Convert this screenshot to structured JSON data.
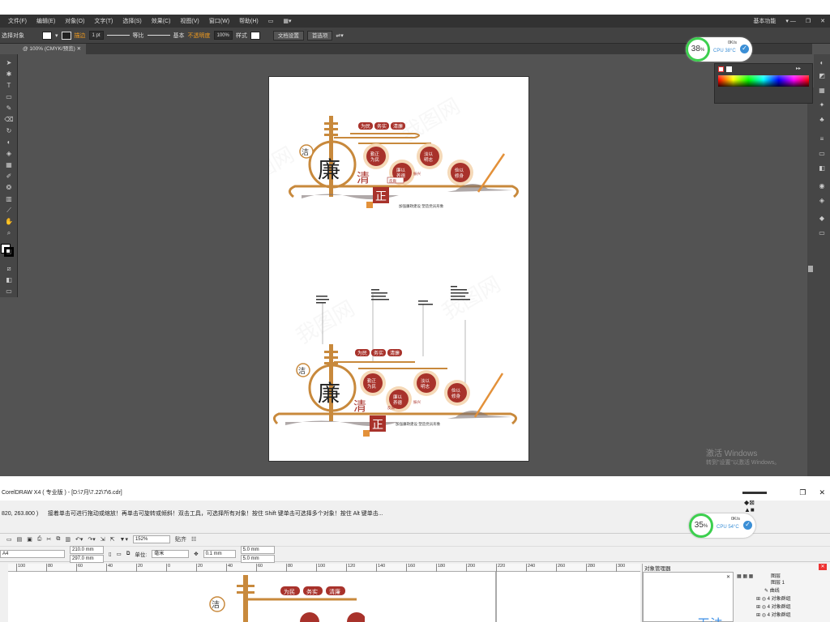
{
  "illustrator": {
    "menu": [
      "文件(F)",
      "编辑(E)",
      "对象(O)",
      "文字(T)",
      "选择(S)",
      "效果(C)",
      "视图(V)",
      "窗口(W)",
      "帮助(H)"
    ],
    "workspace_label": "基本功能",
    "control": {
      "selection_label": "选择对象",
      "stroke_label": "描边",
      "stroke_weight": "1 pt",
      "profile_label": "等比",
      "brush_label": "基本",
      "opacity_label": "不透明度",
      "opacity_value": "100%",
      "style_label": "样式",
      "doc_setup_button": "文档设置",
      "prefs_button": "首选项"
    },
    "document_tab": "@ 100% (CMYK/预览)",
    "activation_line1": "激活 Windows",
    "activation_line2": "转到\"设置\"以激活 Windows。"
  },
  "cpu_widget_top": {
    "percent": "38",
    "unit": "%",
    "speed": "0K/s",
    "label": "CPU 38°C"
  },
  "cpu_widget_bottom": {
    "percent": "35",
    "unit": "%",
    "speed": "0K/s",
    "label": "CPU 54°C"
  },
  "artwork": {
    "char_lian": "廉",
    "char_qing": "清",
    "char_zheng": "正",
    "char_jie": "洁",
    "top_tags": [
      "为民",
      "务实",
      "清廉"
    ],
    "circles": [
      "勤正\n为民",
      "廉以\n养德",
      "淡以\n明志",
      "俭以\n修身"
    ],
    "slogan": "加强廉政建设 塑造党员形象",
    "small_label_left": "反腐",
    "small_label_right": "振兴"
  },
  "coreldraw": {
    "title": "CorelDRAW X4 ( 专业版 ) - [D:\\7月\\7.22\\7\\6.cdr]",
    "coords": "820, 263.800 )",
    "hint": "接着单击可进行拖动或缩放！再单击可旋转或倾斜！双击工具，可选择所有对象！按住 Shift 键单击可选择多个对象！按住 Alt 键单击...",
    "zoom": "152%",
    "snap_label": "贴齐",
    "paper": "A4",
    "width": "210.0 mm",
    "height": "297.0 mm",
    "units_label": "单位:",
    "units_value": "毫米",
    "nudge": "0.1 mm",
    "dup_x": "5.0 mm",
    "dup_y": "5.0 mm",
    "ruler_ticks": [
      "100",
      "80",
      "60",
      "40",
      "20",
      "0",
      "20",
      "40",
      "60",
      "80",
      "100",
      "120",
      "140",
      "160",
      "180",
      "200",
      "220",
      "240",
      "260",
      "280",
      "300"
    ],
    "docker_title": "对象管理器",
    "docker_big": "无法",
    "layers": [
      "图层 1",
      "曲线",
      "4 对象群组",
      "4 对象群组",
      "4 对象群组"
    ],
    "layer_header": "图层"
  },
  "colors": {
    "dark_red": "#a8322b",
    "gold": "#c8893c",
    "orange": "#e3913a",
    "green": "#3ccf4e",
    "blue": "#3b8fd6"
  }
}
